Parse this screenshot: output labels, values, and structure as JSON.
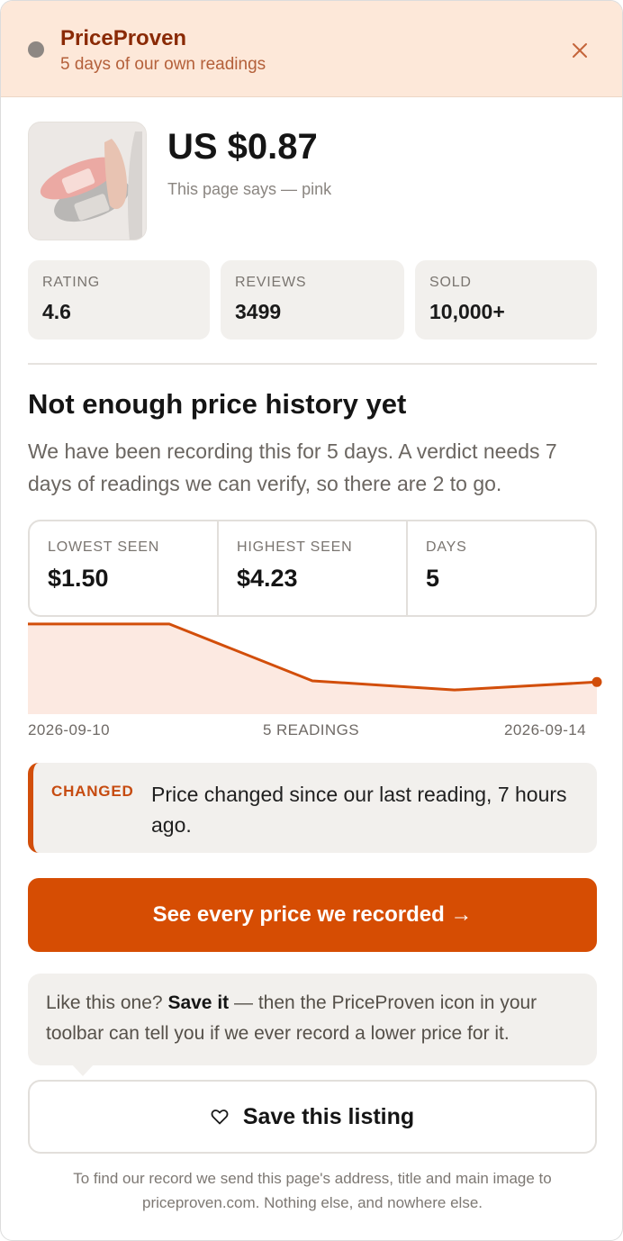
{
  "header": {
    "brand": "PriceProven",
    "subtitle": "5 days of our own readings",
    "close_icon": "close-icon"
  },
  "product": {
    "image_icon": "product-photo",
    "price": "US $0.87",
    "note": "This page says — pink"
  },
  "stats": [
    {
      "label": "RATING",
      "value": "4.6"
    },
    {
      "label": "REVIEWS",
      "value": "3499"
    },
    {
      "label": "SOLD",
      "value": "10,000+"
    }
  ],
  "history": {
    "heading": "Not enough price history yet",
    "body": "We have been recording this for 5 days. A verdict needs 7 days of readings we can verify, so there are 2 to go.",
    "range": [
      {
        "label": "LOWEST SEEN",
        "value": "$1.50"
      },
      {
        "label": "HIGHEST SEEN",
        "value": "$4.23"
      },
      {
        "label": "DAYS",
        "value": "5"
      }
    ]
  },
  "chart_data": {
    "type": "area",
    "x": [
      "2026-09-10",
      "2026-09-11",
      "2026-09-12",
      "2026-09-13",
      "2026-09-14"
    ],
    "values": [
      4.23,
      4.23,
      1.88,
      1.5,
      1.83
    ],
    "ylim": [
      0.5,
      4.3
    ],
    "x_start_label": "2026-09-10",
    "x_mid_label": "5 READINGS",
    "x_end_label": "2026-09-14",
    "line_color": "#d24e0a",
    "fill_color": "#fce9e1"
  },
  "change": {
    "tag": "CHANGED",
    "text": "Price changed since our last reading, 7 hours ago."
  },
  "cta": {
    "label": "See every price we recorded →"
  },
  "tip": {
    "prefix": "Like this one? ",
    "bold": "Save it",
    "suffix": " — then the PriceProven icon in your toolbar can tell you if we ever record a lower price for it."
  },
  "save": {
    "label": "Save this listing",
    "icon": "heart-icon"
  },
  "footer": "To find our record we send this page's address, title and main image to priceproven.com. Nothing else, and nowhere else.",
  "colors": {
    "accent": "#d64d03",
    "header_bg": "#fde8d9",
    "brand": "#8a2a05"
  }
}
